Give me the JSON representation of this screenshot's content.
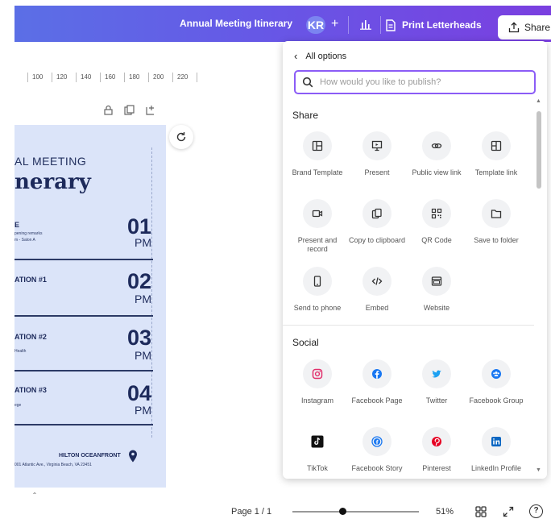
{
  "header": {
    "doc_title": "Annual Meeting Itinerary",
    "avatar_initials": "KR",
    "print_label": "Print Letterheads",
    "share_label": "Share"
  },
  "ruler": {
    "ticks": [
      "100",
      "120",
      "140",
      "160",
      "180",
      "200",
      "220"
    ]
  },
  "design": {
    "heading_small": "AL MEETING",
    "heading_large": "nerary",
    "rows": [
      {
        "title": "E",
        "sub1": "pening remarks",
        "sub2": "m - Salon A",
        "num": "01",
        "pm": "PM"
      },
      {
        "title": "ATION #1",
        "sub1": "",
        "sub2": "",
        "num": "02",
        "pm": "PM"
      },
      {
        "title": "ATION #2",
        "sub1": "Health",
        "sub2": "",
        "num": "03",
        "pm": "PM"
      },
      {
        "title": "ATION #3",
        "sub1": "ege",
        "sub2": "",
        "num": "04",
        "pm": "PM"
      }
    ],
    "venue": "HILTON OCEANFRONT",
    "address": "001 Atlantic Ave., Virginia Beach, VA 23451"
  },
  "panel": {
    "back_label": "All options",
    "search_placeholder": "How would you like to publish?",
    "share_title": "Share",
    "share_items": [
      {
        "label": "Brand Template",
        "icon": "brand-template-icon"
      },
      {
        "label": "Present",
        "icon": "present-icon"
      },
      {
        "label": "Public view link",
        "icon": "link-icon"
      },
      {
        "label": "Template link",
        "icon": "template-link-icon"
      },
      {
        "label": "Present and record",
        "icon": "record-icon"
      },
      {
        "label": "Copy to clipboard",
        "icon": "copy-icon"
      },
      {
        "label": "QR Code",
        "icon": "qr-code-icon"
      },
      {
        "label": "Save to folder",
        "icon": "folder-icon"
      },
      {
        "label": "Send to phone",
        "icon": "phone-icon"
      },
      {
        "label": "Embed",
        "icon": "embed-icon"
      },
      {
        "label": "Website",
        "icon": "website-icon"
      }
    ],
    "social_title": "Social",
    "social_items": [
      {
        "label": "Instagram",
        "icon": "instagram-icon",
        "color": "#e1306c"
      },
      {
        "label": "Facebook Page",
        "icon": "facebook-icon",
        "color": "#1877f2"
      },
      {
        "label": "Twitter",
        "icon": "twitter-icon",
        "color": "#1da1f2"
      },
      {
        "label": "Facebook Group",
        "icon": "facebook-group-icon",
        "color": "#1877f2"
      },
      {
        "label": "TikTok",
        "icon": "tiktok-icon",
        "color": "#111111"
      },
      {
        "label": "Facebook Story",
        "icon": "facebook-story-icon",
        "color": "#1877f2"
      },
      {
        "label": "Pinterest",
        "icon": "pinterest-icon",
        "color": "#e60023"
      },
      {
        "label": "LinkedIn Profile",
        "icon": "linkedin-icon",
        "color": "#0a66c2"
      }
    ]
  },
  "footer": {
    "page_count": "Page 1 / 1",
    "zoom_level": "51%",
    "zoom_fraction": 0.4,
    "help": "?"
  },
  "colors": {
    "accent": "#8b5cf6",
    "design_bg": "#dbe4f9",
    "navy": "#1d2a5b"
  }
}
